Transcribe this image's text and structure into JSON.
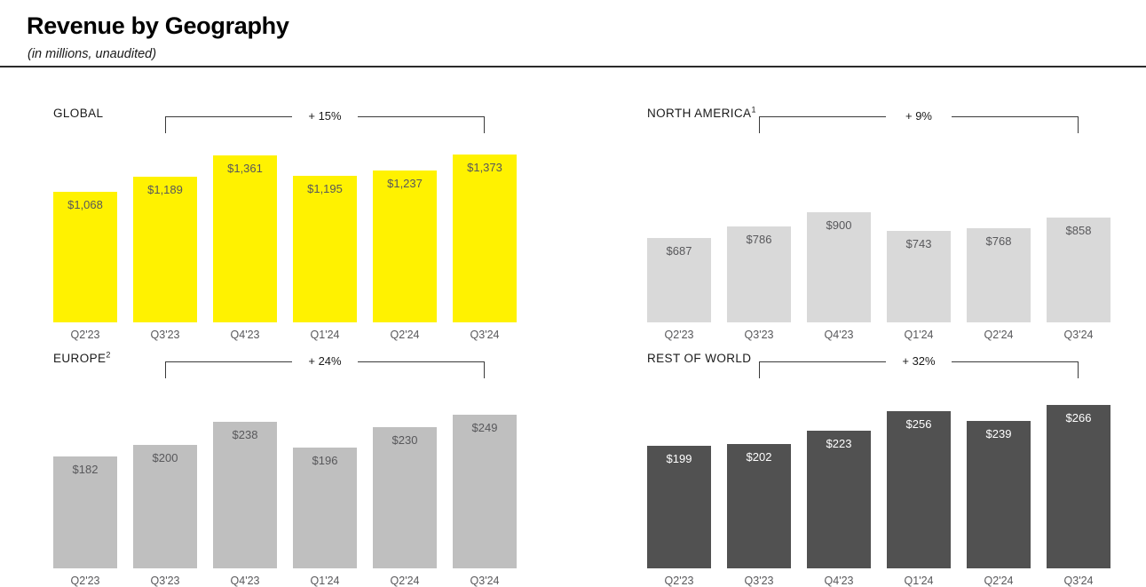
{
  "header": {
    "title": "Revenue by Geography",
    "subtitle": "(in millions, unaudited)"
  },
  "colors": {
    "global_bar": "#FFF200",
    "north_america_bar": "#D9D9D9",
    "europe_bar": "#BFBFBF",
    "rest_of_world_bar": "#515151",
    "dark_label_text": "#58585b",
    "light_label_text": "#FFFFFF",
    "bracket": "#3a3a3a",
    "rule": "#2b2b2b"
  },
  "chart_data": [
    {
      "type": "bar",
      "title": "GLOBAL",
      "title_superscript": "",
      "xlabel": "",
      "ylabel": "",
      "ylim": [
        0,
        1500
      ],
      "grid": false,
      "legend": "none",
      "bar_color": "#FFF200",
      "value_label_color": "#58585b",
      "categories": [
        "Q2'23",
        "Q3'23",
        "Q4'23",
        "Q1'24",
        "Q2'24",
        "Q3'24"
      ],
      "values": [
        1068,
        1189,
        1361,
        1195,
        1237,
        1373
      ],
      "value_labels": [
        "$1,068",
        "$1,189",
        "$1,361",
        "$1,195",
        "$1,237",
        "$1,373"
      ],
      "annotation": {
        "label": "+ 15%",
        "from_category": "Q3'23",
        "to_category": "Q3'24"
      }
    },
    {
      "type": "bar",
      "title": "NORTH AMERICA",
      "title_superscript": "1",
      "xlabel": "",
      "ylabel": "",
      "ylim": [
        0,
        1500
      ],
      "grid": false,
      "legend": "none",
      "bar_color": "#D9D9D9",
      "value_label_color": "#58585b",
      "categories": [
        "Q2'23",
        "Q3'23",
        "Q4'23",
        "Q1'24",
        "Q2'24",
        "Q3'24"
      ],
      "values": [
        687,
        786,
        900,
        743,
        768,
        858
      ],
      "value_labels": [
        "$687",
        "$786",
        "$900",
        "$743",
        "$768",
        "$858"
      ],
      "annotation": {
        "label": "+ 9%",
        "from_category": "Q3'23",
        "to_category": "Q3'24"
      }
    },
    {
      "type": "bar",
      "title": "EUROPE",
      "title_superscript": "2",
      "xlabel": "",
      "ylabel": "",
      "ylim": [
        0,
        300
      ],
      "grid": false,
      "legend": "none",
      "bar_color": "#BFBFBF",
      "value_label_color": "#58585b",
      "categories": [
        "Q2'23",
        "Q3'23",
        "Q4'23",
        "Q1'24",
        "Q2'24",
        "Q3'24"
      ],
      "values": [
        182,
        200,
        238,
        196,
        230,
        249
      ],
      "value_labels": [
        "$182",
        "$200",
        "$238",
        "$196",
        "$230",
        "$249"
      ],
      "annotation": {
        "label": "+ 24%",
        "from_category": "Q3'23",
        "to_category": "Q3'24"
      }
    },
    {
      "type": "bar",
      "title": "REST OF WORLD",
      "title_superscript": "",
      "xlabel": "",
      "ylabel": "",
      "ylim": [
        0,
        300
      ],
      "grid": false,
      "legend": "none",
      "bar_color": "#515151",
      "value_label_color": "#FFFFFF",
      "categories": [
        "Q2'23",
        "Q3'23",
        "Q4'23",
        "Q1'24",
        "Q2'24",
        "Q3'24"
      ],
      "values": [
        199,
        202,
        223,
        256,
        239,
        266
      ],
      "value_labels": [
        "$199",
        "$202",
        "$223",
        "$256",
        "$239",
        "$266"
      ],
      "annotation": {
        "label": "+ 32%",
        "from_category": "Q3'23",
        "to_category": "Q3'24"
      }
    }
  ]
}
